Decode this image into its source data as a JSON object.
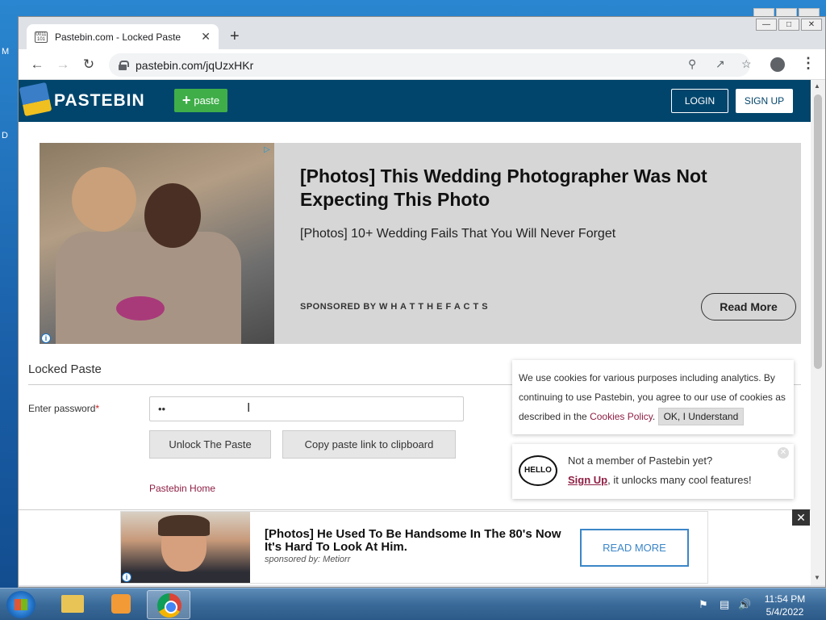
{
  "browser": {
    "tab_title": "Pastebin.com - Locked Paste",
    "url": "pastebin.com/jqUzxHKr"
  },
  "header": {
    "logo_text": "PASTEBIN",
    "paste_label": "paste",
    "login_label": "LOGIN",
    "signup_label": "SIGN UP"
  },
  "ad_top": {
    "headline": "[Photos] This Wedding Photographer Was Not Expecting This Photo",
    "subheadline": "[Photos] 10+ Wedding Fails That You Will Never Forget",
    "sponsor": "SPONSORED BY W H A T T H E F A C T S",
    "cta": "Read More"
  },
  "locked": {
    "title": "Locked Paste",
    "password_label": "Enter password",
    "required_mark": "*",
    "password_value": "••",
    "unlock_label": "Unlock The Paste",
    "copy_label": "Copy paste link to clipboard",
    "home_link": "Pastebin Home"
  },
  "cookie": {
    "text_before": "We use cookies for various purposes including analytics. By continuing to use Pastebin, you agree to our use of cookies as described in the ",
    "policy_link": "Cookies Policy",
    "text_after": ".",
    "ok_label": "OK, I Understand"
  },
  "member": {
    "hello": "HELLO",
    "line1": "Not a member of Pastebin yet?",
    "signup_link": "Sign Up",
    "line2_rest": ", it unlocks many cool features!"
  },
  "ad_bottom": {
    "headline": "[Photos] He Used To Be Handsome In The 80's Now It's Hard To Look At Him.",
    "sponsor": "sponsored by: Metiorr",
    "cta": "READ MORE"
  },
  "taskbar": {
    "time": "11:54 PM",
    "date": "5/4/2022"
  },
  "desktop": {
    "letter1": "M",
    "letter2": "D"
  }
}
